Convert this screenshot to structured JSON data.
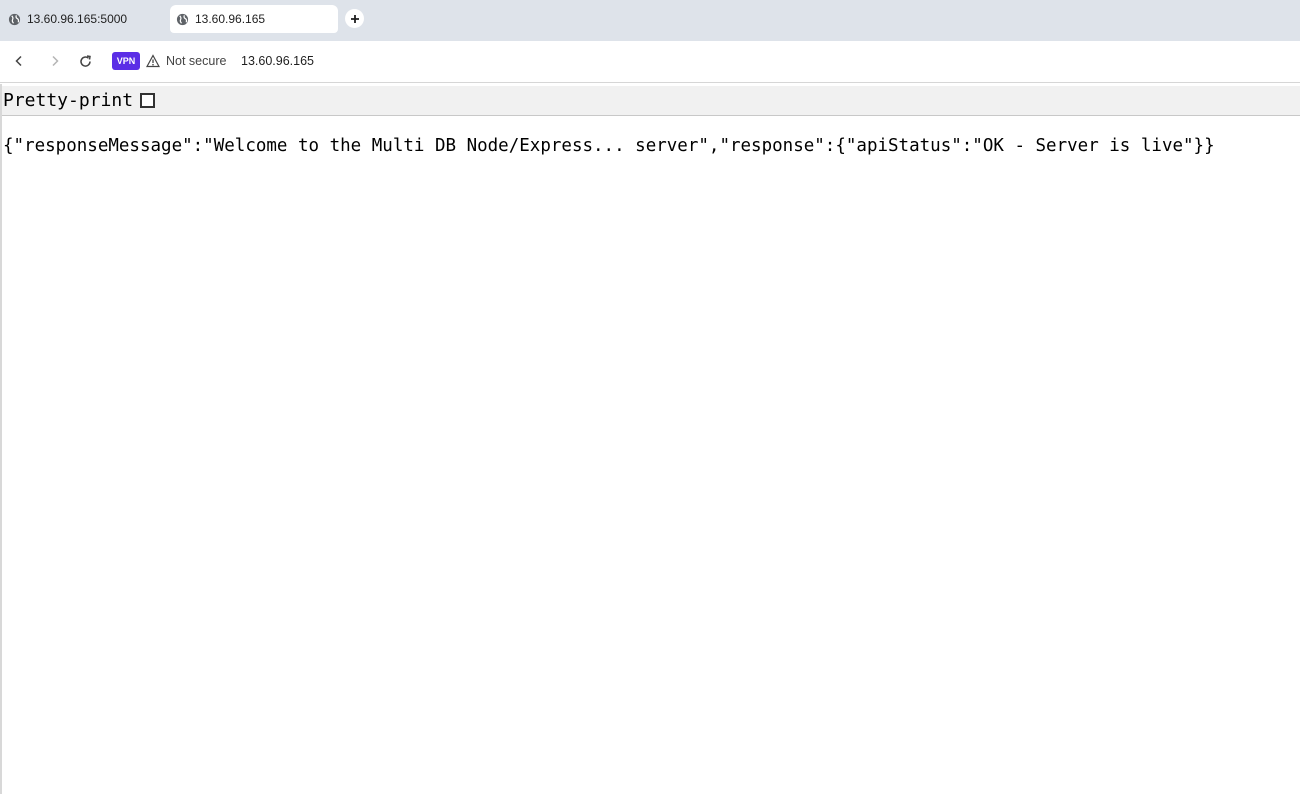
{
  "tabs": [
    {
      "title": "13.60.96.165:5000",
      "icon": "globe-icon",
      "active": false
    },
    {
      "title": "13.60.96.165",
      "icon": "globe-icon",
      "active": true
    }
  ],
  "toolbar": {
    "vpn_label": "VPN",
    "security_text": "Not secure",
    "url": "13.60.96.165"
  },
  "viewer": {
    "pretty_print_label": "Pretty-print",
    "pretty_print_checked": false,
    "json_text": "{\"responseMessage\":\"Welcome to the Multi DB Node/Express... server\",\"response\":{\"apiStatus\":\"OK - Server is live\"}}"
  },
  "colors": {
    "tabstrip": "#dee3ea",
    "vpn_badge": "#5b2ee6",
    "page_bg": "#ffffff"
  }
}
